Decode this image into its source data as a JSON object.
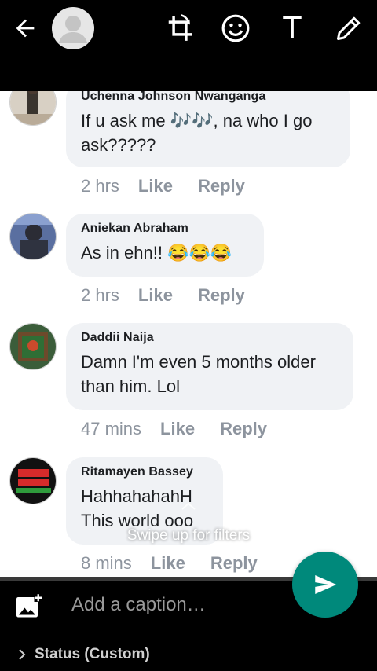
{
  "header": {
    "back_icon": "arrow-left-icon",
    "profile_icon": "person-icon",
    "tools": [
      "crop-rotate-icon",
      "emoji-icon",
      "text-icon",
      "pencil-icon"
    ],
    "text_tool_glyph": "T"
  },
  "comments": [
    {
      "author": "Uchenna Johnson Nwanganga",
      "text": "If u ask me 🎶🎶, na who I go ask?????",
      "time": "2 hrs",
      "like": "Like",
      "reply": "Reply"
    },
    {
      "author": "Aniekan Abraham",
      "text": "As in ehn!! 😂😂😂",
      "time": "2 hrs",
      "like": "Like",
      "reply": "Reply"
    },
    {
      "author": "Daddii Naija",
      "text": "Damn I'm even 5 months older than him. Lol",
      "time": "47 mins",
      "like": "Like",
      "reply": "Reply"
    },
    {
      "author": "Ritamayen Bassey",
      "text": "HahhahahahH This world ooo",
      "time": "8 mins",
      "like": "Like",
      "reply": "Reply"
    }
  ],
  "overlay": {
    "swipe_hint": "Swipe up for filters"
  },
  "footer": {
    "caption_placeholder": "Add a caption…",
    "status_label": "Status (Custom)",
    "send_icon": "send-icon",
    "add_media_icon": "add-photo-icon"
  },
  "colors": {
    "send_button": "#00897b",
    "bubble": "#f0f2f5",
    "meta_text": "#8d949e"
  }
}
